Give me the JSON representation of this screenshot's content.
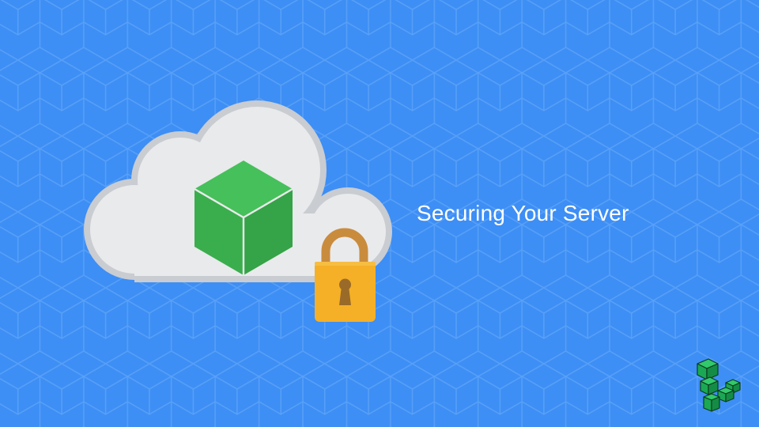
{
  "banner": {
    "title": "Securing Your Server",
    "background_color": "#3d8ef5",
    "pattern_line_color": "#5ba2f7"
  },
  "illustration": {
    "cloud_color": "#e9eaec",
    "cloud_shadow_color": "#c9ccd1",
    "cube_icon": "green-cube-icon",
    "cube_color": "#3fb34f",
    "lock_icon": "padlock-icon",
    "lock_body_color": "#f5b027",
    "lock_shackle_color": "#c98c3d",
    "keyhole_color": "#9a6b28"
  },
  "brand": {
    "logo_icon": "linode-logo-icon",
    "logo_color": "#1cb35b"
  }
}
